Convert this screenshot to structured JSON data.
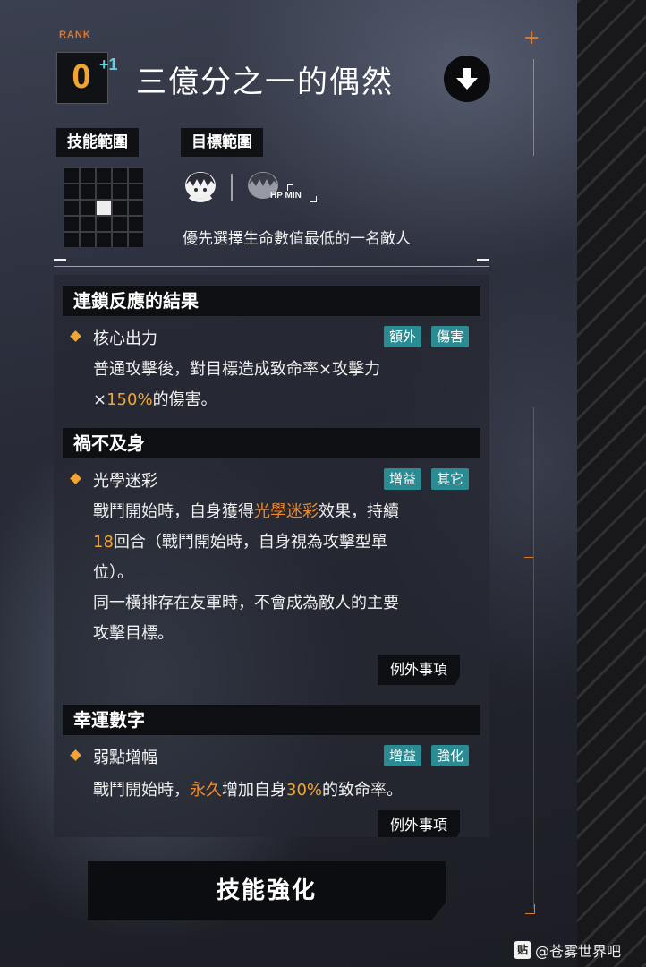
{
  "header": {
    "rank_label": "RANK",
    "rank_value": "0",
    "rank_bonus": "+1",
    "skill_title": "三億分之一的偶然"
  },
  "labels": {
    "skill_range": "技能範圍",
    "target_range": "目標範圍"
  },
  "range_grid": {
    "size": 5,
    "highlight": [
      2,
      2
    ]
  },
  "target": {
    "hp_badge": "HP MIN",
    "description": "優先選擇生命數值最低的一名敵人"
  },
  "sections": [
    {
      "title": "連鎖反應的結果",
      "effect_name": "核心出力",
      "tags": [
        "額外",
        "傷害"
      ],
      "lines": [
        [
          {
            "t": "普通攻擊後，對目標造成致命率×攻擊力"
          }
        ],
        [
          {
            "t": "×"
          },
          {
            "t": "150%",
            "c": "gold"
          },
          {
            "t": "的傷害。"
          }
        ]
      ]
    },
    {
      "title": "禍不及身",
      "effect_name": "光學迷彩",
      "tags": [
        "增益",
        "其它"
      ],
      "lines": [
        [
          {
            "t": "戰鬥開始時，自身獲得"
          },
          {
            "t": "光學迷彩",
            "c": "orange"
          },
          {
            "t": "效果，持續"
          }
        ],
        [
          {
            "t": "18",
            "c": "gold"
          },
          {
            "t": "回合（戰鬥開始時，自身視為攻擊型單"
          }
        ],
        [
          {
            "t": "位）。"
          }
        ],
        [
          {
            "t": "同一橫排存在友軍時，不會成為敵人的主要"
          }
        ],
        [
          {
            "t": "攻擊目標。"
          }
        ]
      ],
      "exception_button": "例外事項"
    },
    {
      "title": "幸運數字",
      "effect_name": "弱點增幅",
      "tags": [
        "增益",
        "強化"
      ],
      "lines": [
        [
          {
            "t": "戰鬥開始時，"
          },
          {
            "t": "永久",
            "c": "orange"
          },
          {
            "t": "增加自身"
          },
          {
            "t": "30%",
            "c": "gold"
          },
          {
            "t": "的致命率。"
          }
        ]
      ],
      "exception_button": "例外事項"
    }
  ],
  "enhance_button": "技能強化",
  "watermark": {
    "icon_text": "贴",
    "text": "@苍雾世界吧"
  },
  "colors": {
    "accent_orange": "#ef8a2b",
    "accent_gold": "#f2a531",
    "tag_teal": "#2a8c92",
    "rank_bonus_cyan": "#5fd3e6"
  }
}
